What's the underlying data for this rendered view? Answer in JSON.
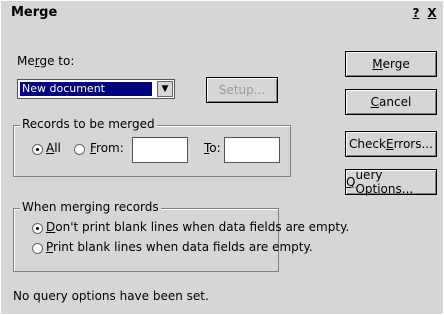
{
  "dialog": {
    "title": "Merge",
    "help_glyph": "?",
    "close_glyph": "X"
  },
  "merge_to": {
    "label_pre": "Me",
    "label_u": "r",
    "label_post": "ge to:",
    "selected": "New document"
  },
  "buttons": {
    "setup": "Setup...",
    "merge_u": "M",
    "merge_post": "erge",
    "cancel_u": "C",
    "cancel_post": "ancel",
    "check_pre": "Check ",
    "check_u": "E",
    "check_post": "rrors...",
    "query_u": "Q",
    "query_post": "uery Options..."
  },
  "records": {
    "group_title": "Records to be merged",
    "all_u": "A",
    "all_post": "ll",
    "from_u": "F",
    "from_post": "rom:",
    "to_u": "T",
    "to_post": "o:",
    "from_value": "",
    "to_value": ""
  },
  "blank_lines": {
    "group_title": "When merging records",
    "opt1_u": "D",
    "opt1_post": "on't print blank lines when data fields are empty.",
    "opt2_u": "P",
    "opt2_post": "rint blank lines when data fields are empty."
  },
  "status": {
    "text": "No query options have been set."
  }
}
